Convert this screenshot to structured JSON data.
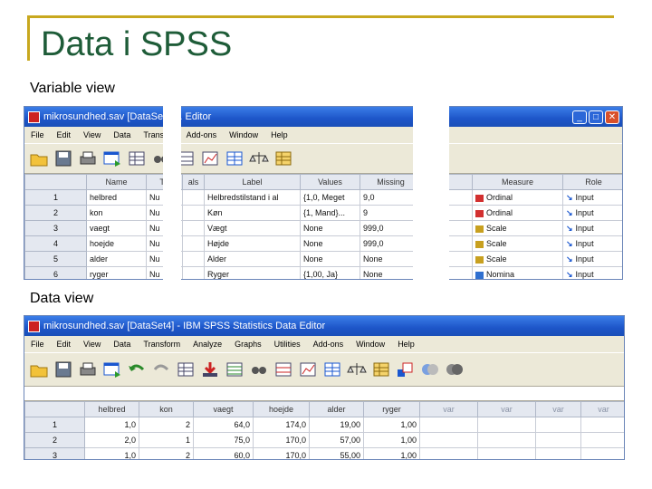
{
  "slide": {
    "title": "Data i SPSS",
    "caption_variable": "Variable view",
    "caption_data": "Data view"
  },
  "colors": {
    "title": "#1e5c38",
    "rule": "#c8a81e",
    "titlebar": "#1d55c8"
  },
  "variable_view": {
    "window_title": "mikrosundhed.sav [DataSet4 ... Editor",
    "menu": [
      "File",
      "Edit",
      "View",
      "Data",
      "Transfor",
      "Add-ons",
      "Window",
      "Help"
    ],
    "columns_left": [
      "",
      "Name",
      "Tu"
    ],
    "columns_mid": [
      "als",
      "Label",
      "Values",
      "Missing"
    ],
    "columns_right": [
      "Measure",
      "Role"
    ],
    "rows": [
      {
        "num": "1",
        "name": "helbred",
        "type": "Nu",
        "dec": "",
        "label": "Helbredstilstand i al",
        "values": "{1,0, Meget",
        "missing": "9,0",
        "measure": "Ordinal",
        "measure_icon": "ordinal-icon",
        "role": "Input"
      },
      {
        "num": "2",
        "name": "kon",
        "type": "Nu",
        "dec": "",
        "label": "Køn",
        "values": "{1, Mand}...",
        "missing": "9",
        "measure": "Ordinal",
        "measure_icon": "ordinal-icon",
        "role": "Input"
      },
      {
        "num": "3",
        "name": "vaegt",
        "type": "Nu",
        "dec": "",
        "label": "Vægt",
        "values": "None",
        "missing": "999,0",
        "measure": "Scale",
        "measure_icon": "scale-icon",
        "role": "Input"
      },
      {
        "num": "4",
        "name": "hoejde",
        "type": "Nu",
        "dec": "",
        "label": "Højde",
        "values": "None",
        "missing": "999,0",
        "measure": "Scale",
        "measure_icon": "scale-icon",
        "role": "Input"
      },
      {
        "num": "5",
        "name": "alder",
        "type": "Nu",
        "dec": "",
        "label": "Alder",
        "values": "None",
        "missing": "None",
        "measure": "Scale",
        "measure_icon": "scale-icon",
        "role": "Input"
      },
      {
        "num": "6",
        "name": "ryger",
        "type": "Nu",
        "dec": "",
        "label": "Ryger",
        "values": "{1,00, Ja}",
        "missing": "None",
        "measure": "Nomina",
        "measure_icon": "nominal-icon",
        "role": "Input"
      }
    ]
  },
  "data_view": {
    "window_title": "mikrosundhed.sav [DataSet4] - IBM SPSS Statistics Data Editor",
    "menu": [
      "File",
      "Edit",
      "View",
      "Data",
      "Transform",
      "Analyze",
      "Graphs",
      "Utilities",
      "Add-ons",
      "Window",
      "Help"
    ],
    "columns": [
      "",
      "helbred",
      "kon",
      "vaegt",
      "hoejde",
      "alder",
      "ryger",
      "var",
      "var",
      "var",
      "var"
    ],
    "rows": [
      {
        "num": "1",
        "cells": [
          "1,0",
          "2",
          "64,0",
          "174,0",
          "19,00",
          "1,00",
          "",
          "",
          "",
          ""
        ]
      },
      {
        "num": "2",
        "cells": [
          "2,0",
          "1",
          "75,0",
          "170,0",
          "57,00",
          "1,00",
          "",
          "",
          "",
          ""
        ]
      },
      {
        "num": "3",
        "cells": [
          "1,0",
          "2",
          "60,0",
          "170,0",
          "55,00",
          "1,00",
          "",
          "",
          "",
          ""
        ]
      }
    ]
  }
}
